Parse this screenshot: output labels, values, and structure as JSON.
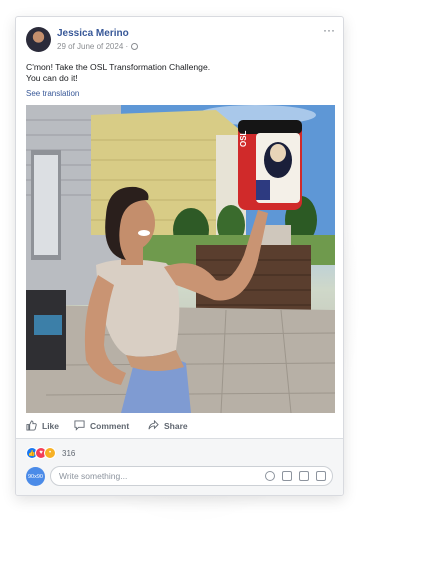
{
  "post": {
    "author": "Jessica Merino",
    "date": "29 of June of 2024 ·",
    "more_label": "···",
    "text_line1": "C'mon! Take the OSL Transformation Challenge.",
    "text_line2": "You can do it!",
    "see_translation": "See translation"
  },
  "photo": {
    "product_label": "OSL"
  },
  "actions": {
    "like": "Like",
    "comment": "Comment",
    "share": "Share"
  },
  "footer": {
    "reaction_count": "316",
    "avatar_text": "90x90",
    "comment_placeholder": "Write something..."
  },
  "colors": {
    "link": "#385898",
    "like_blue": "#1877f2",
    "love_red": "#f33e58",
    "wow_yellow": "#f7b125"
  }
}
